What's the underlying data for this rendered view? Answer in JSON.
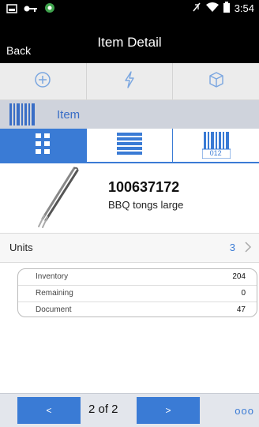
{
  "status_bar": {
    "time": "3:54"
  },
  "header": {
    "back_label": "Back",
    "title": "Item Detail"
  },
  "action_bar": {
    "buttons": [
      "add-circle-icon",
      "lightning-icon",
      "cube-icon"
    ]
  },
  "section": {
    "label": "Item"
  },
  "tabs": {
    "active_index": 0,
    "barcode_label": "012"
  },
  "item": {
    "number": "100637172",
    "description": "BBQ tongs large"
  },
  "units": {
    "label": "Units",
    "value": "3"
  },
  "quantities": [
    {
      "label": "Inventory",
      "value": "204"
    },
    {
      "label": "Remaining",
      "value": "0"
    },
    {
      "label": "Document",
      "value": "47"
    }
  ],
  "footer": {
    "prev_label": "<",
    "page": "2 of 2",
    "next_label": ">",
    "more_label": "ooo"
  },
  "colors": {
    "accent": "#3a7bd5",
    "section_bg": "#cfd3dc",
    "header_bg": "#000000"
  }
}
